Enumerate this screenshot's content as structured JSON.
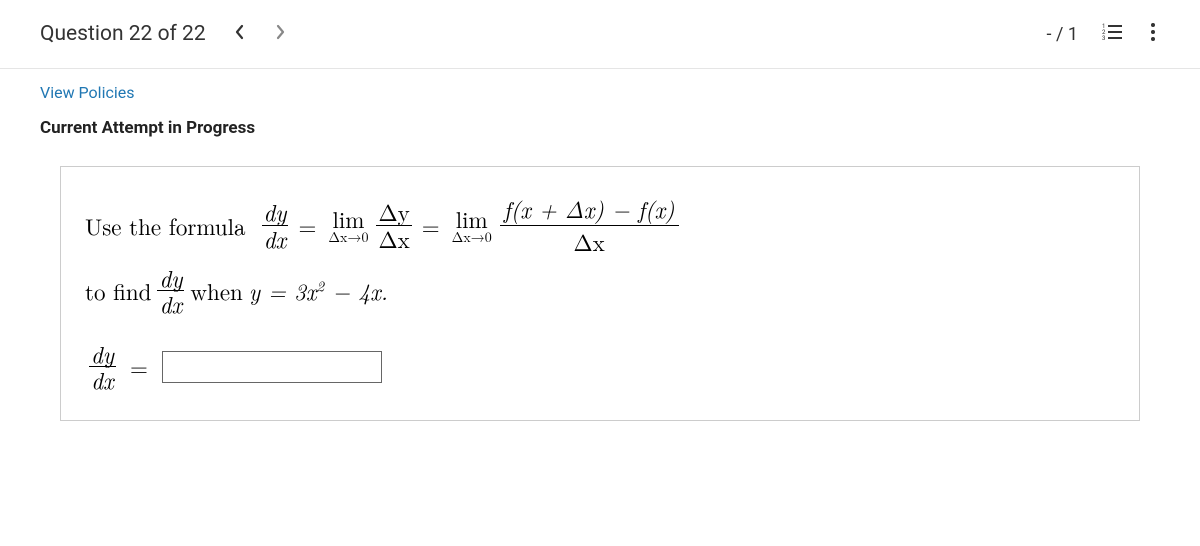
{
  "header": {
    "question_label": "Question 22 of 22",
    "score": "- / 1"
  },
  "subheader": {
    "view_policies": "View Policies",
    "attempt_status": "Current Attempt in Progress"
  },
  "question": {
    "lead_text": "Use the formula",
    "frac1_num": "dy",
    "frac1_den": "dx",
    "eq": "=",
    "lim_label": "lim",
    "lim_sub": "Δx→0",
    "frac2_num": "Δy",
    "frac2_den": "Δx",
    "bigfrac_num": "f(x + Δx) − f(x)",
    "bigfrac_den": "Δx",
    "to_find": "to find",
    "when_text": "when",
    "y_eq": "y = 3x",
    "sup2": "2",
    "minus4x": " − 4x.",
    "answer_value": ""
  },
  "icons": {
    "prev": "chevron-left-icon",
    "next": "chevron-right-icon",
    "list": "list-icon",
    "more": "more-vertical-icon"
  }
}
